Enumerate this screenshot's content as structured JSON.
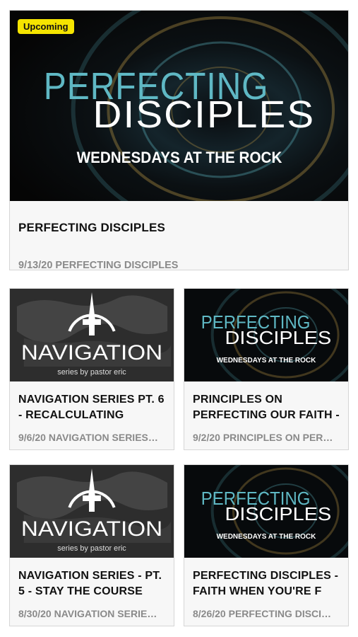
{
  "colors": {
    "badge": "#f5e400",
    "teal": "#5fb8c4",
    "gold": "#c9a34a",
    "title_text": "#111111",
    "meta_text": "#8a8a8a"
  },
  "featured": {
    "badge": "Upcoming",
    "art": {
      "line1": "PERFECTING",
      "line2": "DISCIPLES",
      "tagline": "WEDNESDAYS AT THE ROCK"
    },
    "title": "PERFECTING DISCIPLES",
    "subtitle": "9/13/20 PERFECTING DISCIPLES"
  },
  "cards": [
    {
      "art": {
        "type": "navigation",
        "name": "NAVIGATION",
        "tagline": "series by pastor eric"
      },
      "title": "NAVIGATION SERIES PT. 6 - RECALCULATING",
      "subtitle": "9/6/20 NAVIGATION SERIES…"
    },
    {
      "art": {
        "type": "perfecting",
        "line1": "PERFECTING",
        "line2": "DISCIPLES",
        "tagline": "WEDNESDAYS AT THE ROCK"
      },
      "title": "PRINCIPLES ON PERFECTING OUR FAITH - THE F",
      "subtitle": "9/2/20 PRINCIPLES ON PER…"
    },
    {
      "art": {
        "type": "navigation",
        "name": "NAVIGATION",
        "tagline": "series by pastor eric"
      },
      "title": "NAVIGATION SERIES - PT. 5 - STAY THE COURSE",
      "subtitle": "8/30/20 NAVIGATION SERIE…"
    },
    {
      "art": {
        "type": "perfecting",
        "line1": "PERFECTING",
        "line2": "DISCIPLES",
        "tagline": "WEDNESDAYS AT THE ROCK"
      },
      "title": "PERFECTING DISCIPLES - FAITH WHEN YOU'RE F",
      "subtitle": "8/26/20 PERFECTING DISCI…"
    }
  ]
}
